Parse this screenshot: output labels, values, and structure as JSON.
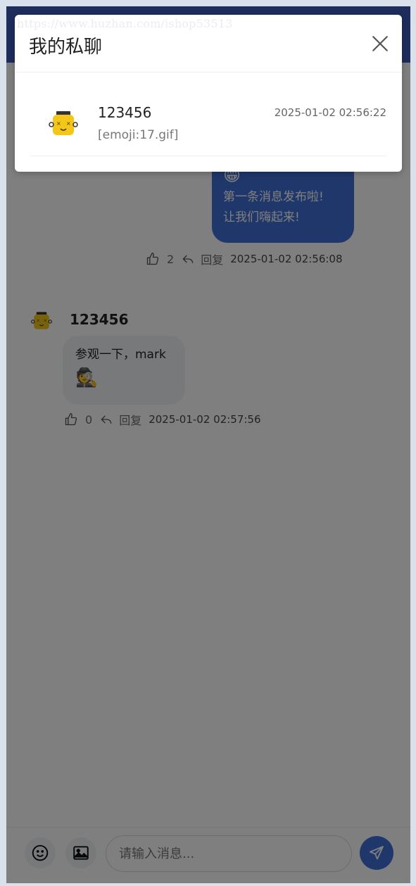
{
  "watermark": "https://www.huzhan.com/ishop53513",
  "modal": {
    "title": "我的私聊",
    "conversations": [
      {
        "name": "123456",
        "time": "2025-01-02 02:56:22",
        "preview": "[emoji:17.gif]"
      }
    ]
  },
  "messages": [
    {
      "direction": "out",
      "emoji": "😁",
      "text_lines": [
        "第一条消息发布啦!",
        "让我们嗨起来!"
      ],
      "likes": "2",
      "reply_label": "回复",
      "time": "2025-01-02 02:56:08"
    },
    {
      "direction": "in",
      "author": "123456",
      "text": "参观一下，mark",
      "emoji": "🕵",
      "likes": "0",
      "reply_label": "回复",
      "time": "2025-01-02 02:57:56"
    }
  ],
  "input": {
    "placeholder": "请输入消息..."
  },
  "colors": {
    "primary": "#3e6fd6",
    "header": "#3a5ab8",
    "page_bg": "#d9e2ea"
  }
}
